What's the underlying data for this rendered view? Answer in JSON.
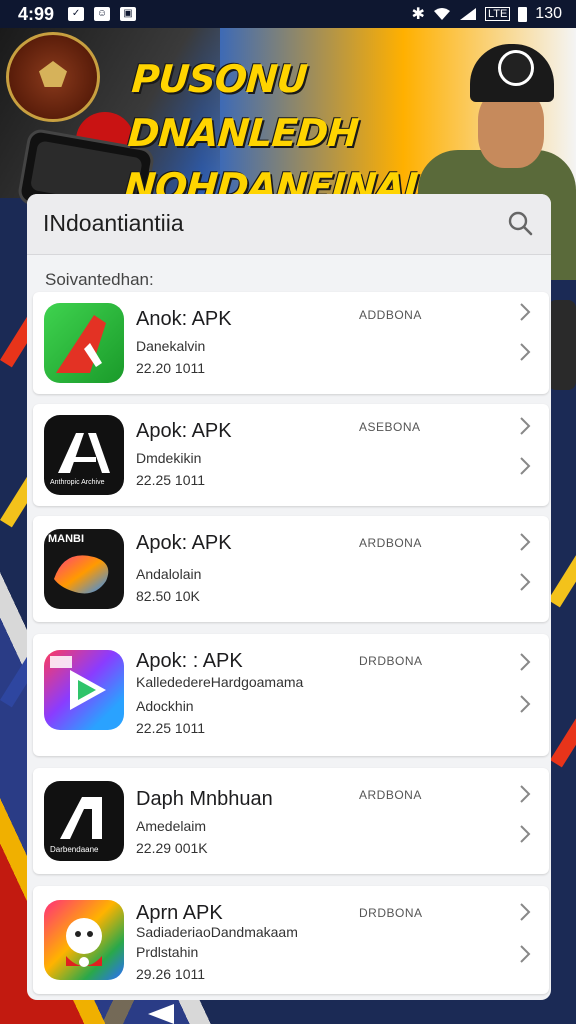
{
  "status_bar": {
    "time": "4:99",
    "network": "LTE",
    "battery": "130"
  },
  "banner": {
    "headline_line1": "PUSONU DNANLEDH",
    "headline_line2": "NOHDANEINAIL.?"
  },
  "search": {
    "query": "INdoantiantiia"
  },
  "section_label": "Soivantedhan:",
  "items": [
    {
      "title": "Anok: APK",
      "subtitle": "Danekalvin",
      "meta": "22.20 1011",
      "tag": "ADDBONA"
    },
    {
      "title": "Apok: APK",
      "subtitle": "Dmdekikin",
      "meta": "22.25 1011",
      "tag": "ASEBONA"
    },
    {
      "title": "Apok: APK",
      "subtitle": "Andalolain",
      "meta": "82.50 10K",
      "tag": "ARDBONA"
    },
    {
      "title": "Apok: : APK",
      "subtitle": "KallededereHardgoamama",
      "meta2": "Adockhin",
      "meta": "22.25 1011",
      "tag": "DRDBONA"
    },
    {
      "title": "Daph Mnbhuan",
      "subtitle": "Amedelaim",
      "meta": "22.29 001K",
      "tag": "ARDBONA"
    },
    {
      "title": "Aprn APK",
      "subtitle": "SadiaderiaoDandmakaam",
      "meta2": "Prdlstahin",
      "meta": "29.26 1011",
      "tag": "DRDBONA"
    }
  ],
  "icon_text": {
    "item2": "Anthropic Archive",
    "item3": "MANBI",
    "item5": "Darbendaane"
  },
  "colors": {
    "accent_yellow": "#ffd400",
    "panel_bg": "#f2f3f5",
    "item_bg": "#ffffff"
  }
}
